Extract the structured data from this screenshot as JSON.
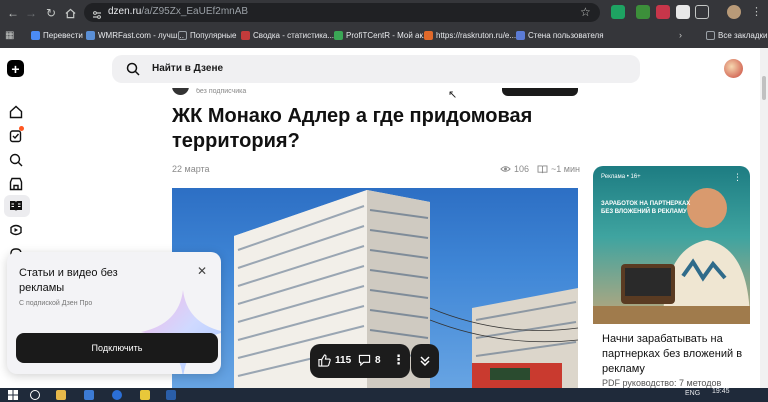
{
  "browser": {
    "url_host": "dzen.ru",
    "url_path": "/a/Z95Zx_EaUEf2mnAB",
    "bookmarks": [
      {
        "label": "Перевести",
        "color": "#4b8bf4"
      },
      {
        "label": "WMRFast.com - лучш...",
        "color": "#5a8fd6"
      },
      {
        "label": "Популярные",
        "color": "#9aa0a6"
      },
      {
        "label": "Сводка - статистика...",
        "color": "#c23b3b"
      },
      {
        "label": "ProfiTCentR - Мой ак...",
        "color": "#3aa655"
      },
      {
        "label": "https://raskruton.ru/e...",
        "color": "#e0692a"
      },
      {
        "label": "Стена пользователя",
        "color": "#5b7bd5"
      }
    ],
    "all_bookmarks": "Все закладки"
  },
  "topbar": {
    "search_text": "Найти в Дзене"
  },
  "article": {
    "author_strip": "без подписчика",
    "title": "ЖК Монако Адлер а где придомовая территория?",
    "date": "22 марта",
    "views": "106",
    "read_time": "~1 мин"
  },
  "actions": {
    "likes": "115",
    "comments": "8"
  },
  "ad": {
    "badge": "Реклама • 16+",
    "promo": "ЗАРАБОТОК НА ПАРТНЕРКАХ БЕЗ ВЛОЖЕНИЙ В РЕКЛАМУ",
    "headline": "Начни зарабатывать на партнерках без вложений в рекламу",
    "sub": "PDF руководство: 7 методов"
  },
  "popup": {
    "heading": "Статьи и видео без рекламы",
    "subtitle": "С подпиской Дзен Про",
    "button": "Подключить"
  },
  "taskbar": {
    "lang": "ENG",
    "time": "19:45"
  },
  "colors": {
    "chrome_bg": "#35363a",
    "accent_dark": "#1a1a1a",
    "notification_dot": "#ff5722"
  }
}
